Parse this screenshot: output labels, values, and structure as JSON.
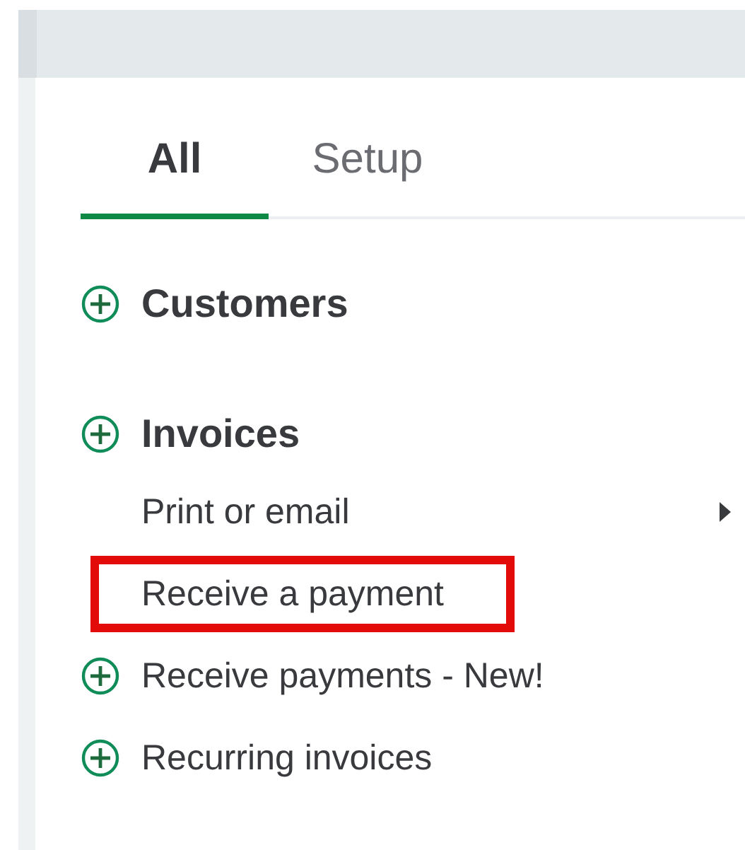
{
  "tabs": [
    {
      "label": "All",
      "selected": true
    },
    {
      "label": "Setup",
      "selected": false
    }
  ],
  "sections": [
    {
      "title": "Customers"
    },
    {
      "title": "Invoices",
      "items": [
        {
          "label": "Print or email",
          "kind": "submenu",
          "highlighted": false
        },
        {
          "label": "Receive a payment",
          "kind": "link",
          "highlighted": true
        },
        {
          "label": "Receive payments - New!",
          "kind": "group",
          "highlighted": false
        },
        {
          "label": "Recurring invoices",
          "kind": "group",
          "highlighted": false
        }
      ]
    }
  ]
}
